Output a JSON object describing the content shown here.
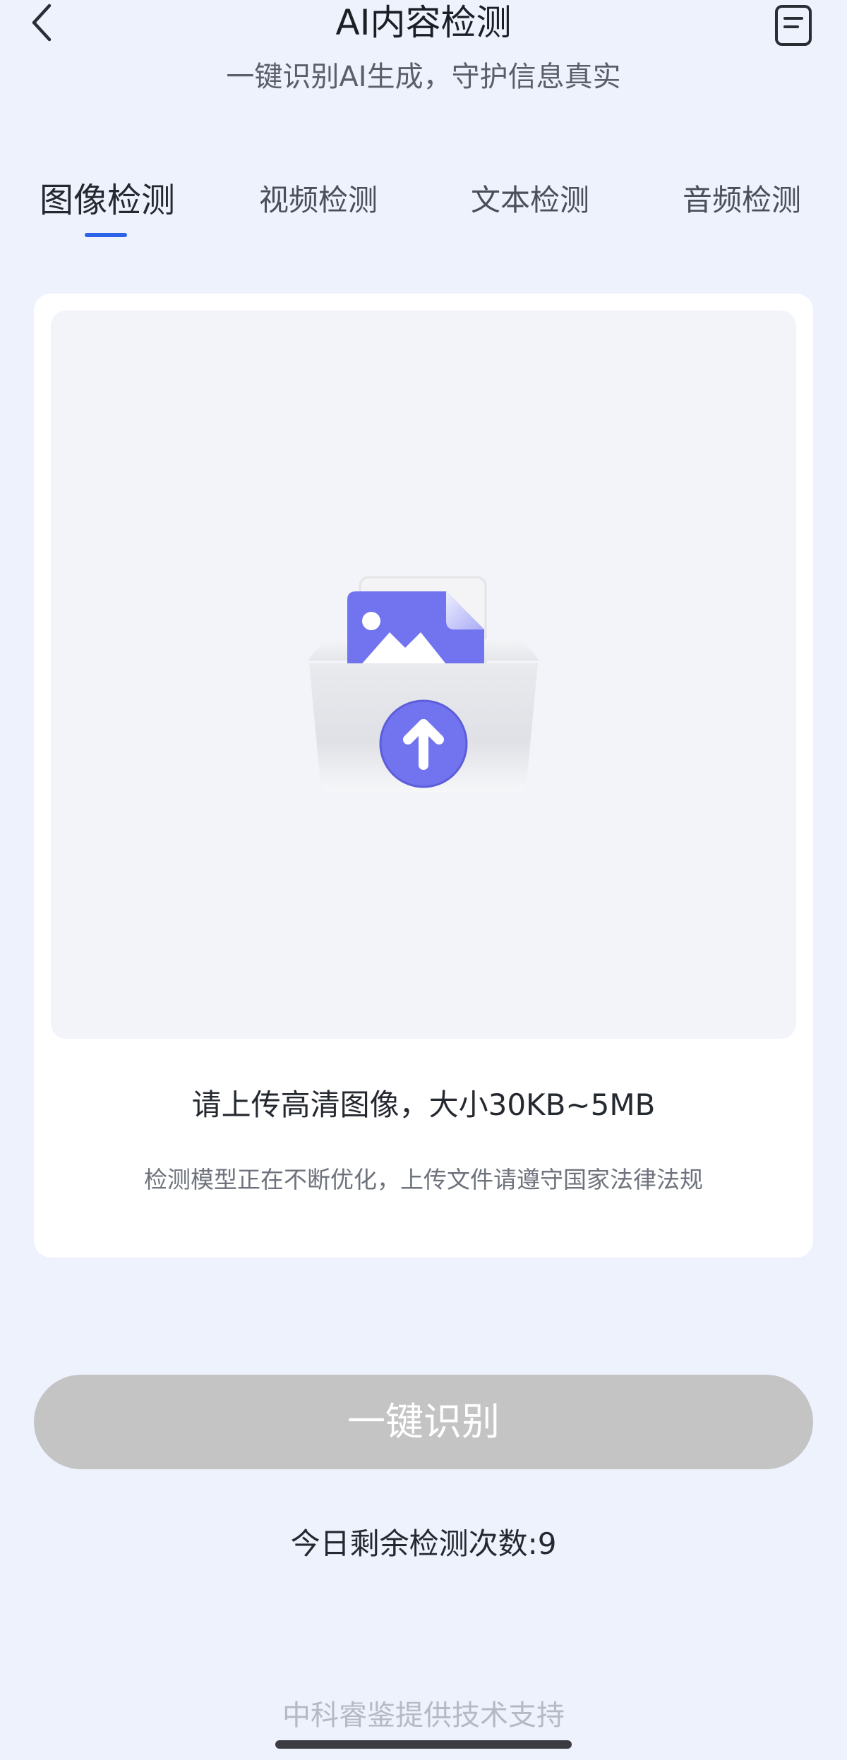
{
  "header": {
    "title": "AI内容检测",
    "subtitle": "一键识别AI生成，守护信息真实",
    "back_icon": "chevron-left-icon",
    "record_icon": "document-list-icon"
  },
  "tabs": [
    {
      "label": "图像检测",
      "active": true
    },
    {
      "label": "视频检测",
      "active": false
    },
    {
      "label": "文本检测",
      "active": false
    },
    {
      "label": "音频检测",
      "active": false
    }
  ],
  "upload": {
    "icon": "image-upload-icon",
    "hint": "请上传高清图像，大小30KB~5MB",
    "note": "检测模型正在不断优化，上传文件请遵守国家法律法规"
  },
  "action": {
    "detect_label": "一键识别"
  },
  "remaining_text": "今日剩余检测次数:9",
  "footer": {
    "credit": "中科睿鉴提供技术支持"
  },
  "colors": {
    "background": "#edf2fd",
    "accent": "#2d63e8",
    "illustration_purple": "#7275ee",
    "button_disabled": "#c4c4c4"
  }
}
